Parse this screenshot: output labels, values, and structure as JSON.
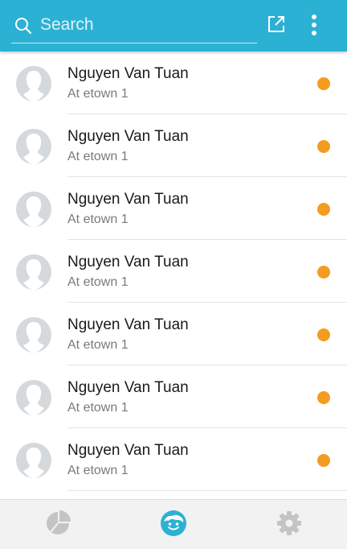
{
  "search": {
    "placeholder": "Search"
  },
  "toolbar": {
    "share_icon": "external-share-icon",
    "more_icon": "more-vert-icon"
  },
  "contacts": [
    {
      "name": "Nguyen Van Tuan",
      "location": "At etown 1",
      "status_color": "#f39c1f"
    },
    {
      "name": "Nguyen Van Tuan",
      "location": "At etown 1",
      "status_color": "#f39c1f"
    },
    {
      "name": "Nguyen Van Tuan",
      "location": "At etown 1",
      "status_color": "#f39c1f"
    },
    {
      "name": "Nguyen Van Tuan",
      "location": "At etown 1",
      "status_color": "#f39c1f"
    },
    {
      "name": "Nguyen Van Tuan",
      "location": "At etown 1",
      "status_color": "#f39c1f"
    },
    {
      "name": "Nguyen Van Tuan",
      "location": "At etown 1",
      "status_color": "#f39c1f"
    },
    {
      "name": "Nguyen Van Tuan",
      "location": "At etown 1",
      "status_color": "#f39c1f"
    }
  ],
  "tabs": [
    {
      "icon": "pie-chart-icon",
      "active": false
    },
    {
      "icon": "face-icon",
      "active": true
    },
    {
      "icon": "gear-icon",
      "active": false
    }
  ],
  "colors": {
    "accent": "#2bb1d3",
    "status": "#f39c1f",
    "inactive_icon": "#bdbdbd"
  }
}
